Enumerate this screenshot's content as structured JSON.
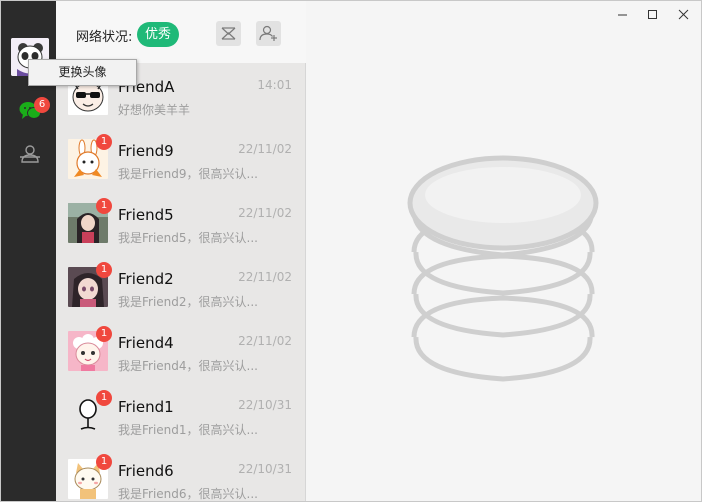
{
  "header": {
    "network_label": "网络状况:",
    "network_status": "优秀"
  },
  "tooltip": {
    "change_avatar": "更换头像"
  },
  "rail": {
    "unread_badge": "6"
  },
  "chats": [
    {
      "name": "FriendA",
      "time": "14:01",
      "message": "好想你美羊羊",
      "badge": ""
    },
    {
      "name": "Friend9",
      "time": "22/11/02",
      "message": "我是Friend9，很高兴认...",
      "badge": "1"
    },
    {
      "name": "Friend5",
      "time": "22/11/02",
      "message": "我是Friend5，很高兴认...",
      "badge": "1"
    },
    {
      "name": "Friend2",
      "time": "22/11/02",
      "message": "我是Friend2，很高兴认...",
      "badge": "1"
    },
    {
      "name": "Friend4",
      "time": "22/11/02",
      "message": "我是Friend4，很高兴认...",
      "badge": "1"
    },
    {
      "name": "Friend1",
      "time": "22/10/31",
      "message": "我是Friend1，很高兴认...",
      "badge": "1"
    },
    {
      "name": "Friend6",
      "time": "22/10/31",
      "message": "我是Friend6，很高兴认...",
      "badge": "1"
    }
  ],
  "icons": {
    "rail": [
      "avatar",
      "chat-bubble-icon",
      "contacts-icon"
    ],
    "header": [
      "mail-icon",
      "add-user-icon"
    ],
    "window": [
      "minimize-icon",
      "maximize-icon",
      "close-icon"
    ],
    "main": [
      "coin-stack-icon"
    ]
  },
  "colors": {
    "rail_bg": "#2b2b2b",
    "list_bg": "#e8e7e6",
    "accent_green": "#1fb978",
    "badge_red": "#f0483e",
    "chat_icon_green": "#1aad19"
  }
}
